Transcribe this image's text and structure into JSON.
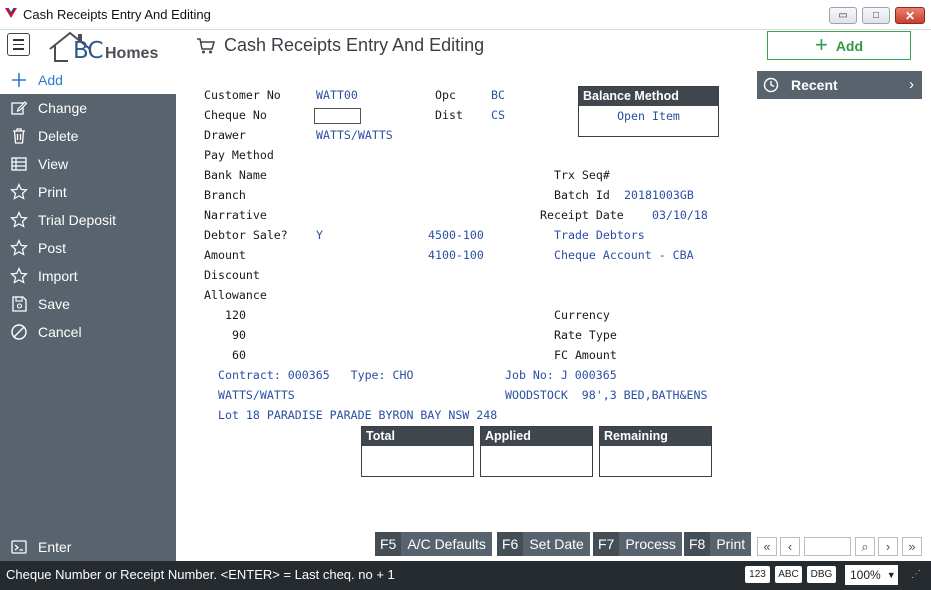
{
  "window": {
    "title": "Cash Receipts Entry And Editing",
    "min_glyph": "▭",
    "max_glyph": "□",
    "close_glyph": "✕"
  },
  "header": {
    "brand_bc": "BC",
    "brand_homes": "Homes",
    "page_title": "Cash Receipts Entry And Editing",
    "add_label": "Add",
    "add_glyph": "+"
  },
  "sidebar": {
    "items": [
      {
        "label": "Add",
        "icon": "plus-icon"
      },
      {
        "label": "Change",
        "icon": "edit-icon"
      },
      {
        "label": "Delete",
        "icon": "trash-icon"
      },
      {
        "label": "View",
        "icon": "table-icon"
      },
      {
        "label": "Print",
        "icon": "star-icon"
      },
      {
        "label": "Trial Deposit",
        "icon": "star-icon"
      },
      {
        "label": "Post",
        "icon": "star-icon"
      },
      {
        "label": "Import",
        "icon": "star-icon"
      },
      {
        "label": "Save",
        "icon": "save-icon"
      },
      {
        "label": "Cancel",
        "icon": "cancel-icon"
      }
    ],
    "enter_label": "Enter"
  },
  "recent": {
    "label": "Recent",
    "chevron": "›"
  },
  "form": {
    "labels": {
      "customer_no": "Customer No",
      "cheque_no": "Cheque No",
      "drawer": "Drawer",
      "pay_method": "Pay Method",
      "bank_name": "Bank Name",
      "branch": "Branch",
      "narrative": "Narrative",
      "debtor_sale": "Debtor Sale?",
      "amount": "Amount",
      "discount": "Discount",
      "allowance": "Allowance",
      "aging_120": "120",
      "aging_90": "90",
      "aging_60": "60",
      "opc": "Opc",
      "dist": "Dist",
      "trx_seq": "Trx Seq#",
      "batch_id": "Batch Id",
      "receipt_date": "Receipt Date",
      "currency": "Currency",
      "rate_type": "Rate Type",
      "fc_amount": "FC Amount"
    },
    "values": {
      "customer_no": "WATT00",
      "drawer": "WATTS/WATTS",
      "debtor_sale": "Y",
      "debtor_sale_gl": "4500-100",
      "amount_gl": "4100-100",
      "opc": "BC",
      "dist": "CS",
      "batch_id": "20181003GB",
      "receipt_date": "03/10/18",
      "trade_debtors": "Trade Debtors",
      "cheque_account": "Cheque Account - CBA"
    },
    "contract": {
      "line1_left": "Contract: 000365   Type: CHO",
      "line1_right": "Job No: J 000365",
      "line2_left": "WATTS/WATTS",
      "line2_right": "WOODSTOCK  98',3 BED,BATH&ENS",
      "line3": "Lot 18 PARADISE PARADE BYRON BAY NSW 248"
    },
    "cheque_value": ""
  },
  "balance_method": {
    "title": "Balance Method",
    "value": "Open Item"
  },
  "totals": {
    "total": "Total",
    "applied": "Applied",
    "remaining": "Remaining"
  },
  "fkeys": [
    {
      "key": "F5",
      "label": "A/C Defaults"
    },
    {
      "key": "F6",
      "label": "Set Date"
    },
    {
      "key": "F7",
      "label": "Process"
    },
    {
      "key": "F8",
      "label": "Print"
    }
  ],
  "pager": {
    "first": "«",
    "prev": "‹",
    "next": "›",
    "last": "»",
    "search_glyph": "⌕"
  },
  "status": {
    "text": "Cheque Number or Receipt Number. <ENTER> = Last cheq. no + 1",
    "b123": "123",
    "abc": "ABC",
    "dbg": "DBG",
    "zoom": "100%"
  }
}
